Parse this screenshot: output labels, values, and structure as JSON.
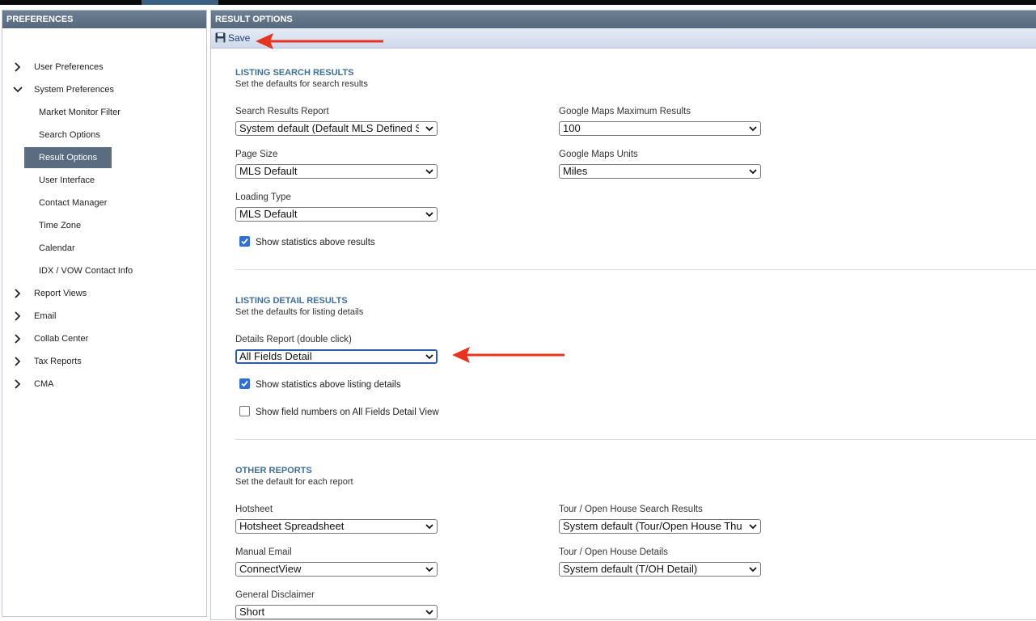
{
  "sidebar": {
    "header": "PREFERENCES",
    "items": [
      {
        "label": "User Preferences"
      },
      {
        "label": "System Preferences"
      },
      {
        "label": "Report Views"
      },
      {
        "label": "Email"
      },
      {
        "label": "Collab Center"
      },
      {
        "label": "Tax Reports"
      },
      {
        "label": "CMA"
      }
    ],
    "system_children": [
      {
        "label": "Market Monitor Filter"
      },
      {
        "label": "Search Options"
      },
      {
        "label": "Result Options"
      },
      {
        "label": "User Interface"
      },
      {
        "label": "Contact Manager"
      },
      {
        "label": "Time Zone"
      },
      {
        "label": "Calendar"
      },
      {
        "label": "IDX / VOW Contact Info"
      }
    ]
  },
  "main": {
    "header": "RESULT OPTIONS",
    "save_label": "Save",
    "search_results": {
      "title": "LISTING SEARCH RESULTS",
      "subtitle": "Set the defaults for search results",
      "report_label": "Search Results Report",
      "report_value": "System default (Default MLS Defined Spreadsheet)",
      "page_size_label": "Page Size",
      "page_size_value": "MLS Default",
      "loading_type_label": "Loading Type",
      "loading_type_value": "MLS Default",
      "maps_max_label": "Google Maps Maximum Results",
      "maps_max_value": "100",
      "maps_units_label": "Google Maps Units",
      "maps_units_value": "Miles",
      "show_stats_label": "Show statistics above results",
      "show_stats_checked": true
    },
    "detail_results": {
      "title": "LISTING DETAIL RESULTS",
      "subtitle": "Set the defaults for listing details",
      "report_label": "Details Report (double click)",
      "report_value": "All Fields Detail",
      "show_stats_label": "Show statistics above listing details",
      "show_stats_checked": true,
      "show_field_numbers_label": "Show field numbers on All Fields Detail View",
      "show_field_numbers_checked": false
    },
    "other_reports": {
      "title": "OTHER REPORTS",
      "subtitle": "Set the default for each report",
      "hotsheet_label": "Hotsheet",
      "hotsheet_value": "Hotsheet Spreadsheet",
      "manual_email_label": "Manual Email",
      "manual_email_value": "ConnectView",
      "disclaimer_label": "General Disclaimer",
      "disclaimer_value": "Short",
      "tour_search_label": "Tour / Open House Search Results",
      "tour_search_value": "System default (Tour/Open House Thumbnail)",
      "tour_details_label": "Tour / Open House Details",
      "tour_details_value": "System default (T/OH Detail)"
    }
  },
  "colors": {
    "header_bg": "#5f7185",
    "active_item_bg": "#5a6c80",
    "section_title": "#3f6f9a",
    "checkbox_on": "#2f6fd6",
    "annotation_arrow": "#e8331e"
  }
}
